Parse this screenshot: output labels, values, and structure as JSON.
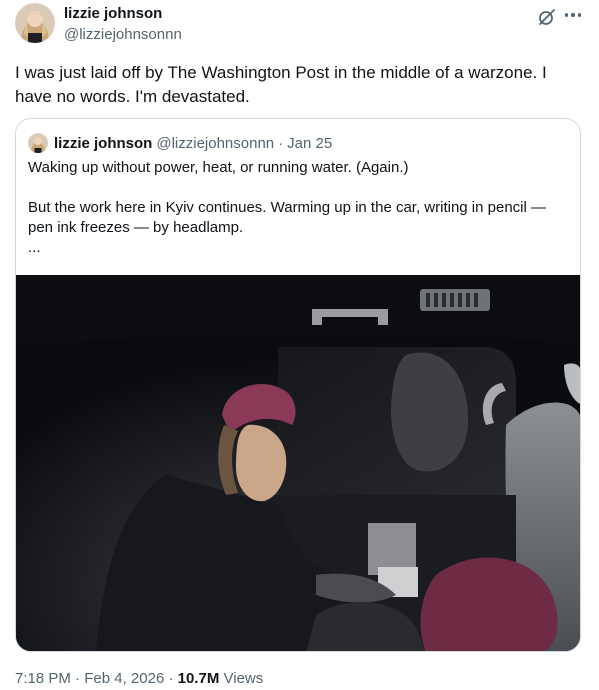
{
  "tweet": {
    "author_name": "lizzie johnson",
    "author_handle": "@lizziejohnsonnn",
    "text": "I was just laid off by The Washington Post in the middle of a warzone. I have no words. I'm devastated.",
    "time": "7:18 PM",
    "separator": "·",
    "date": "Feb 4, 2026",
    "views_count": "10.7M",
    "views_label": "Views"
  },
  "quote": {
    "author_name": "lizzie johnson",
    "author_handle": "@lizziejohnsonnn",
    "separator": "·",
    "date": "Jan 25",
    "line1": "Waking up without power, heat, or running water. (Again.)",
    "line2": "But the work here in Kyiv continues. Warming up in the car, writing in pencil — pen ink freezes — by headlamp.",
    "ellipsis": "..."
  },
  "icons": {
    "grok": "grok-icon",
    "more": "more-icon"
  },
  "colors": {
    "text_primary": "#0f1419",
    "text_secondary": "#536471",
    "border": "#cfd9de",
    "hat_pink": "#8a3a57"
  }
}
